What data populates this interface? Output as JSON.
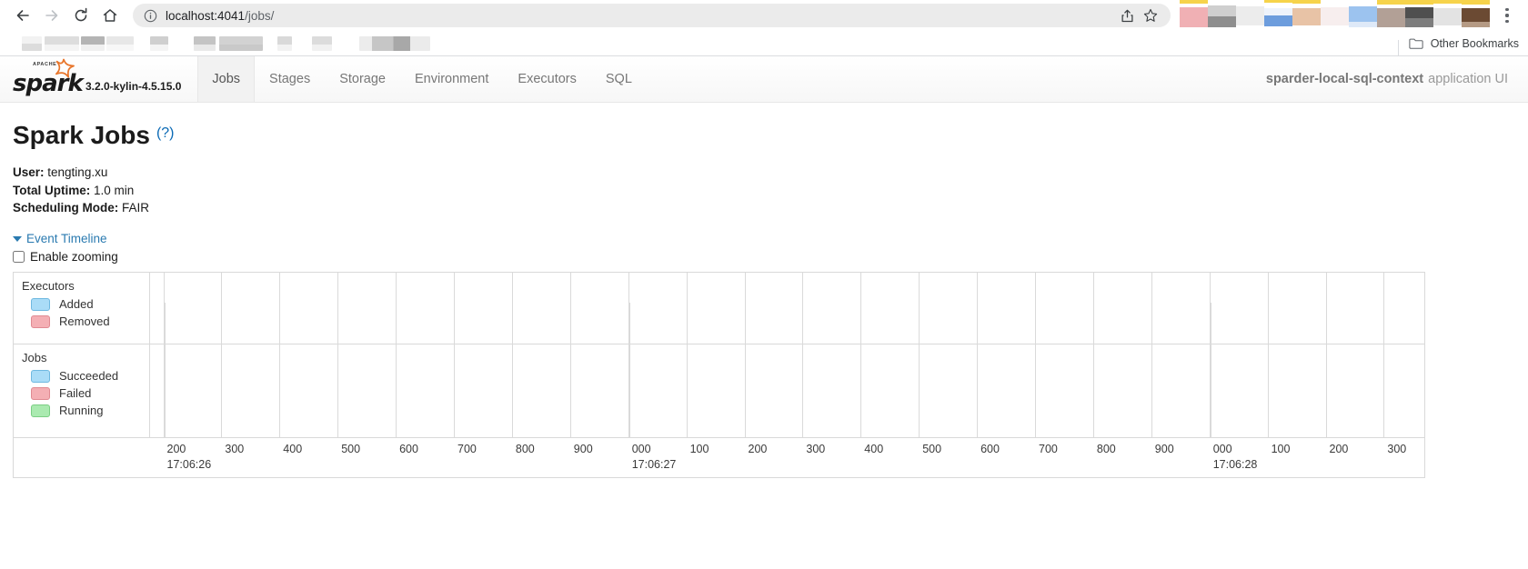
{
  "browser": {
    "nav": {
      "back_icon": "arrow-left-icon",
      "forward_icon": "arrow-right-icon",
      "reload_icon": "reload-icon",
      "home_icon": "home-icon"
    },
    "omnibox": {
      "info_icon": "site-info-icon",
      "url_host": "localhost:4041",
      "url_path": "/jobs/",
      "share_icon": "share-icon",
      "bookmark_icon": "star-icon"
    },
    "menu_icon": "three-dot-menu-icon",
    "bookmarks": {
      "folder_icon": "folder-icon",
      "other_bookmarks_label": "Other Bookmarks"
    }
  },
  "spark": {
    "brand": {
      "logo_word": "spark",
      "logo_apache": "APACHE",
      "version": "3.2.0-kylin-4.5.15.0"
    },
    "tabs": [
      {
        "label": "Jobs",
        "active": true
      },
      {
        "label": "Stages",
        "active": false
      },
      {
        "label": "Storage",
        "active": false
      },
      {
        "label": "Environment",
        "active": false
      },
      {
        "label": "Executors",
        "active": false
      },
      {
        "label": "SQL",
        "active": false
      }
    ],
    "app_name": "sparder-local-sql-context",
    "app_suffix": "application UI"
  },
  "page": {
    "title": "Spark Jobs",
    "help_link": "(?)",
    "meta": [
      {
        "key": "User:",
        "value": "tengting.xu"
      },
      {
        "key": "Total Uptime:",
        "value": "1.0 min"
      },
      {
        "key": "Scheduling Mode:",
        "value": "FAIR"
      }
    ],
    "event_timeline_label": "Event Timeline",
    "enable_zooming_label": "Enable zooming",
    "enable_zooming_checked": false
  },
  "timeline": {
    "legend_groups": [
      {
        "title": "Executors",
        "items": [
          {
            "label": "Added",
            "fill": "#aadcf7",
            "stroke": "#6fb8e0"
          },
          {
            "label": "Removed",
            "fill": "#f4afb4",
            "stroke": "#e08a92"
          }
        ]
      },
      {
        "title": "Jobs",
        "items": [
          {
            "label": "Succeeded",
            "fill": "#aadcf7",
            "stroke": "#6fb8e0"
          },
          {
            "label": "Failed",
            "fill": "#f4afb4",
            "stroke": "#e08a92"
          },
          {
            "label": "Running",
            "fill": "#aaeab0",
            "stroke": "#7bce84"
          }
        ]
      }
    ],
    "events": [],
    "axis": {
      "ticks": [
        {
          "ms": "200",
          "sec": "17:06:26"
        },
        {
          "ms": "300",
          "sec": ""
        },
        {
          "ms": "400",
          "sec": ""
        },
        {
          "ms": "500",
          "sec": ""
        },
        {
          "ms": "600",
          "sec": ""
        },
        {
          "ms": "700",
          "sec": ""
        },
        {
          "ms": "800",
          "sec": ""
        },
        {
          "ms": "900",
          "sec": ""
        },
        {
          "ms": "000",
          "sec": "17:06:27"
        },
        {
          "ms": "100",
          "sec": ""
        },
        {
          "ms": "200",
          "sec": ""
        },
        {
          "ms": "300",
          "sec": ""
        },
        {
          "ms": "400",
          "sec": ""
        },
        {
          "ms": "500",
          "sec": ""
        },
        {
          "ms": "600",
          "sec": ""
        },
        {
          "ms": "700",
          "sec": ""
        },
        {
          "ms": "800",
          "sec": ""
        },
        {
          "ms": "900",
          "sec": ""
        },
        {
          "ms": "000",
          "sec": "17:06:28"
        },
        {
          "ms": "100",
          "sec": ""
        },
        {
          "ms": "200",
          "sec": ""
        },
        {
          "ms": "300",
          "sec": ""
        }
      ]
    }
  },
  "colors": {
    "accent_link": "#2a7ab0",
    "spark_orange": "#e8752a",
    "active_tab_bg": "#f2f2f2",
    "border": "#d9d9d9"
  }
}
